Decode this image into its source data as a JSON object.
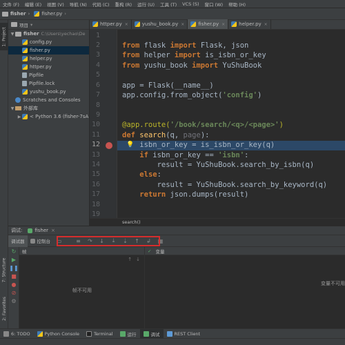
{
  "menu": [
    "文件 (F)",
    "编辑 (E)",
    "视图 (V)",
    "导航 (N)",
    "代码 (C)",
    "重构 (R)",
    "运行 (U)",
    "工具 (T)",
    "VCS (S)",
    "窗口 (W)",
    "帮助 (H)"
  ],
  "breadcrumb": {
    "project": "fisher",
    "file": "fisher.py"
  },
  "left_strip": {
    "project_tab": "1: Project",
    "structure_tab": "7: Structure",
    "favorites_tab": "2: Favorites"
  },
  "project": {
    "header": "项目",
    "root": {
      "name": "fisher",
      "path": "C:\\Users\\yechao\\De"
    },
    "files": [
      "config.py",
      "fisher.py",
      "helper.py",
      "httper.py",
      "Pipfile",
      "Pipfile.lock",
      "yushu_book.py"
    ],
    "scratches": "Scratches and Consoles",
    "external_libs": "外部库",
    "python_sdk": "< Python 3.6 (fisher-7sA"
  },
  "tabs": [
    "httper.py",
    "yushu_book.py",
    "fisher.py",
    "helper.py"
  ],
  "editor": {
    "line_numbers": [
      "1",
      "2",
      "3",
      "4",
      "5",
      "6",
      "7",
      "8",
      "9",
      "10",
      "11",
      "12",
      "13",
      "14",
      "15",
      "16",
      "17",
      "18",
      "19"
    ],
    "current_line": "12",
    "code_crumb": "search()"
  },
  "debug": {
    "title": "调试:",
    "session": "fisher",
    "tab_debugger": "调试器",
    "tab_console": "控制台",
    "frames_header": "帧",
    "frames_empty": "帧不可用",
    "vars_header": "变量",
    "vars_empty": "变量不可用"
  },
  "bottom": {
    "todo": "6: TODO",
    "python_console": "Python Console",
    "terminal": "Terminal",
    "run": "运行",
    "debug": "调试",
    "rest_client": "REST Client"
  }
}
